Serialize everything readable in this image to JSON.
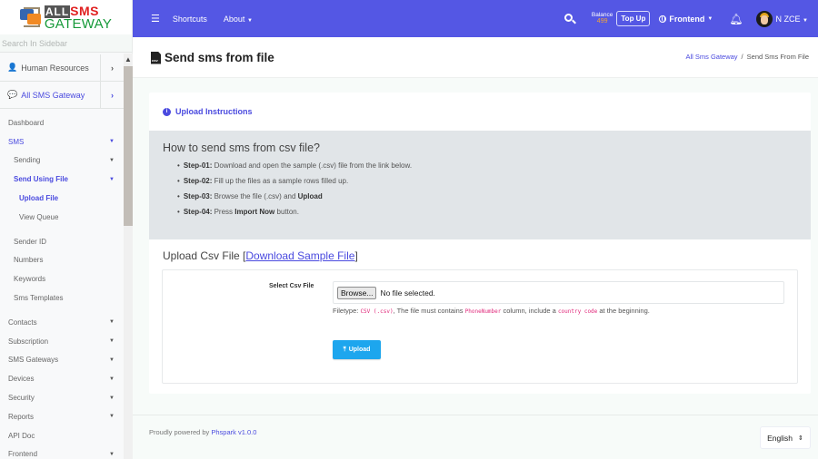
{
  "logo": {
    "top_a": "ALL",
    "top_b": "SMS",
    "bottom": "GATEWAY"
  },
  "sidebar": {
    "search_placeholder": "Search In Sidebar",
    "accordions": [
      {
        "label": "Human Resources",
        "icon": "user-icon",
        "active": false
      },
      {
        "label": "All SMS Gateway",
        "icon": "comments-icon",
        "active": true
      }
    ],
    "items": [
      {
        "label": "Dashboard",
        "level": 0,
        "caret": false,
        "active": false
      },
      {
        "label": "SMS",
        "level": 0,
        "caret": true,
        "active": true
      },
      {
        "label": "Sending",
        "level": 1,
        "caret": true,
        "active": false
      },
      {
        "label": "Send Using File",
        "level": 1,
        "caret": true,
        "active": true
      },
      {
        "label": "Upload File",
        "level": 2,
        "caret": false,
        "active": true
      },
      {
        "label": "View Queue",
        "level": 2,
        "caret": false,
        "active": false
      },
      {
        "label": "Sender ID",
        "level": 1,
        "caret": false,
        "active": false
      },
      {
        "label": "Numbers",
        "level": 1,
        "caret": false,
        "active": false
      },
      {
        "label": "Keywords",
        "level": 1,
        "caret": false,
        "active": false
      },
      {
        "label": "Sms Templates",
        "level": 1,
        "caret": false,
        "active": false
      },
      {
        "label": "Contacts",
        "level": 0,
        "caret": true,
        "active": false
      },
      {
        "label": "Subscription",
        "level": 0,
        "caret": true,
        "active": false
      },
      {
        "label": "SMS Gateways",
        "level": 0,
        "caret": true,
        "active": false
      },
      {
        "label": "Devices",
        "level": 0,
        "caret": true,
        "active": false
      },
      {
        "label": "Security",
        "level": 0,
        "caret": true,
        "active": false
      },
      {
        "label": "Reports",
        "level": 0,
        "caret": true,
        "active": false
      },
      {
        "label": "API Doc",
        "level": 0,
        "caret": false,
        "active": false
      },
      {
        "label": "Frontend",
        "level": 0,
        "caret": true,
        "active": false
      }
    ]
  },
  "topnav": {
    "menu_icon": "hamburger-icon",
    "shortcuts": "Shortcuts",
    "about": "About",
    "balance_label": "Balance",
    "balance_value": "499",
    "topup": "Top Up",
    "frontend": "Frontend",
    "user": "N ZCE"
  },
  "page": {
    "title": "Send sms from file",
    "file_icon_text": "csv",
    "breadcrumb": {
      "parent": "All Sms Gateway",
      "separator": "/",
      "current": "Send Sms From File"
    }
  },
  "card": {
    "header": "Upload Instructions",
    "instructions_title": "How to send sms from csv file?",
    "steps": [
      {
        "label": "Step-01:",
        "text": " Download and open the sample (.csv) file from the link below.",
        "bold": "",
        "tail": ""
      },
      {
        "label": "Step-02:",
        "text": " Fill up the files as a sample rows filled up.",
        "bold": "",
        "tail": ""
      },
      {
        "label": "Step-03:",
        "text": " Browse the file (.csv) and ",
        "bold": "Upload",
        "tail": ""
      },
      {
        "label": "Step-04:",
        "text": " Press ",
        "bold": "Import Now",
        "tail": " button."
      }
    ],
    "upload_title": "Upload Csv File [",
    "download_link": "Download Sample File",
    "upload_title_end": "]",
    "field_label": "Select Csv File",
    "browse": "Browse...",
    "no_file": "No file selected.",
    "hint_a": "Filetype: ",
    "hint_code1": "CSV (.csv)",
    "hint_b": ", The file must contains ",
    "hint_code2": "PhoneNumber",
    "hint_c": " column, include a ",
    "hint_code3": "country code",
    "hint_d": " at the beginning.",
    "upload_button": "Upload"
  },
  "footer": {
    "credit": "Proudly powered by ",
    "credit_link": "Phspark v1.0.0",
    "language": "English"
  },
  "colors": {
    "nav": "#5457e4",
    "accent": "#4a4adf",
    "upload_btn": "#1da6ee",
    "balance": "#f4a534",
    "code": "#e0287a"
  }
}
